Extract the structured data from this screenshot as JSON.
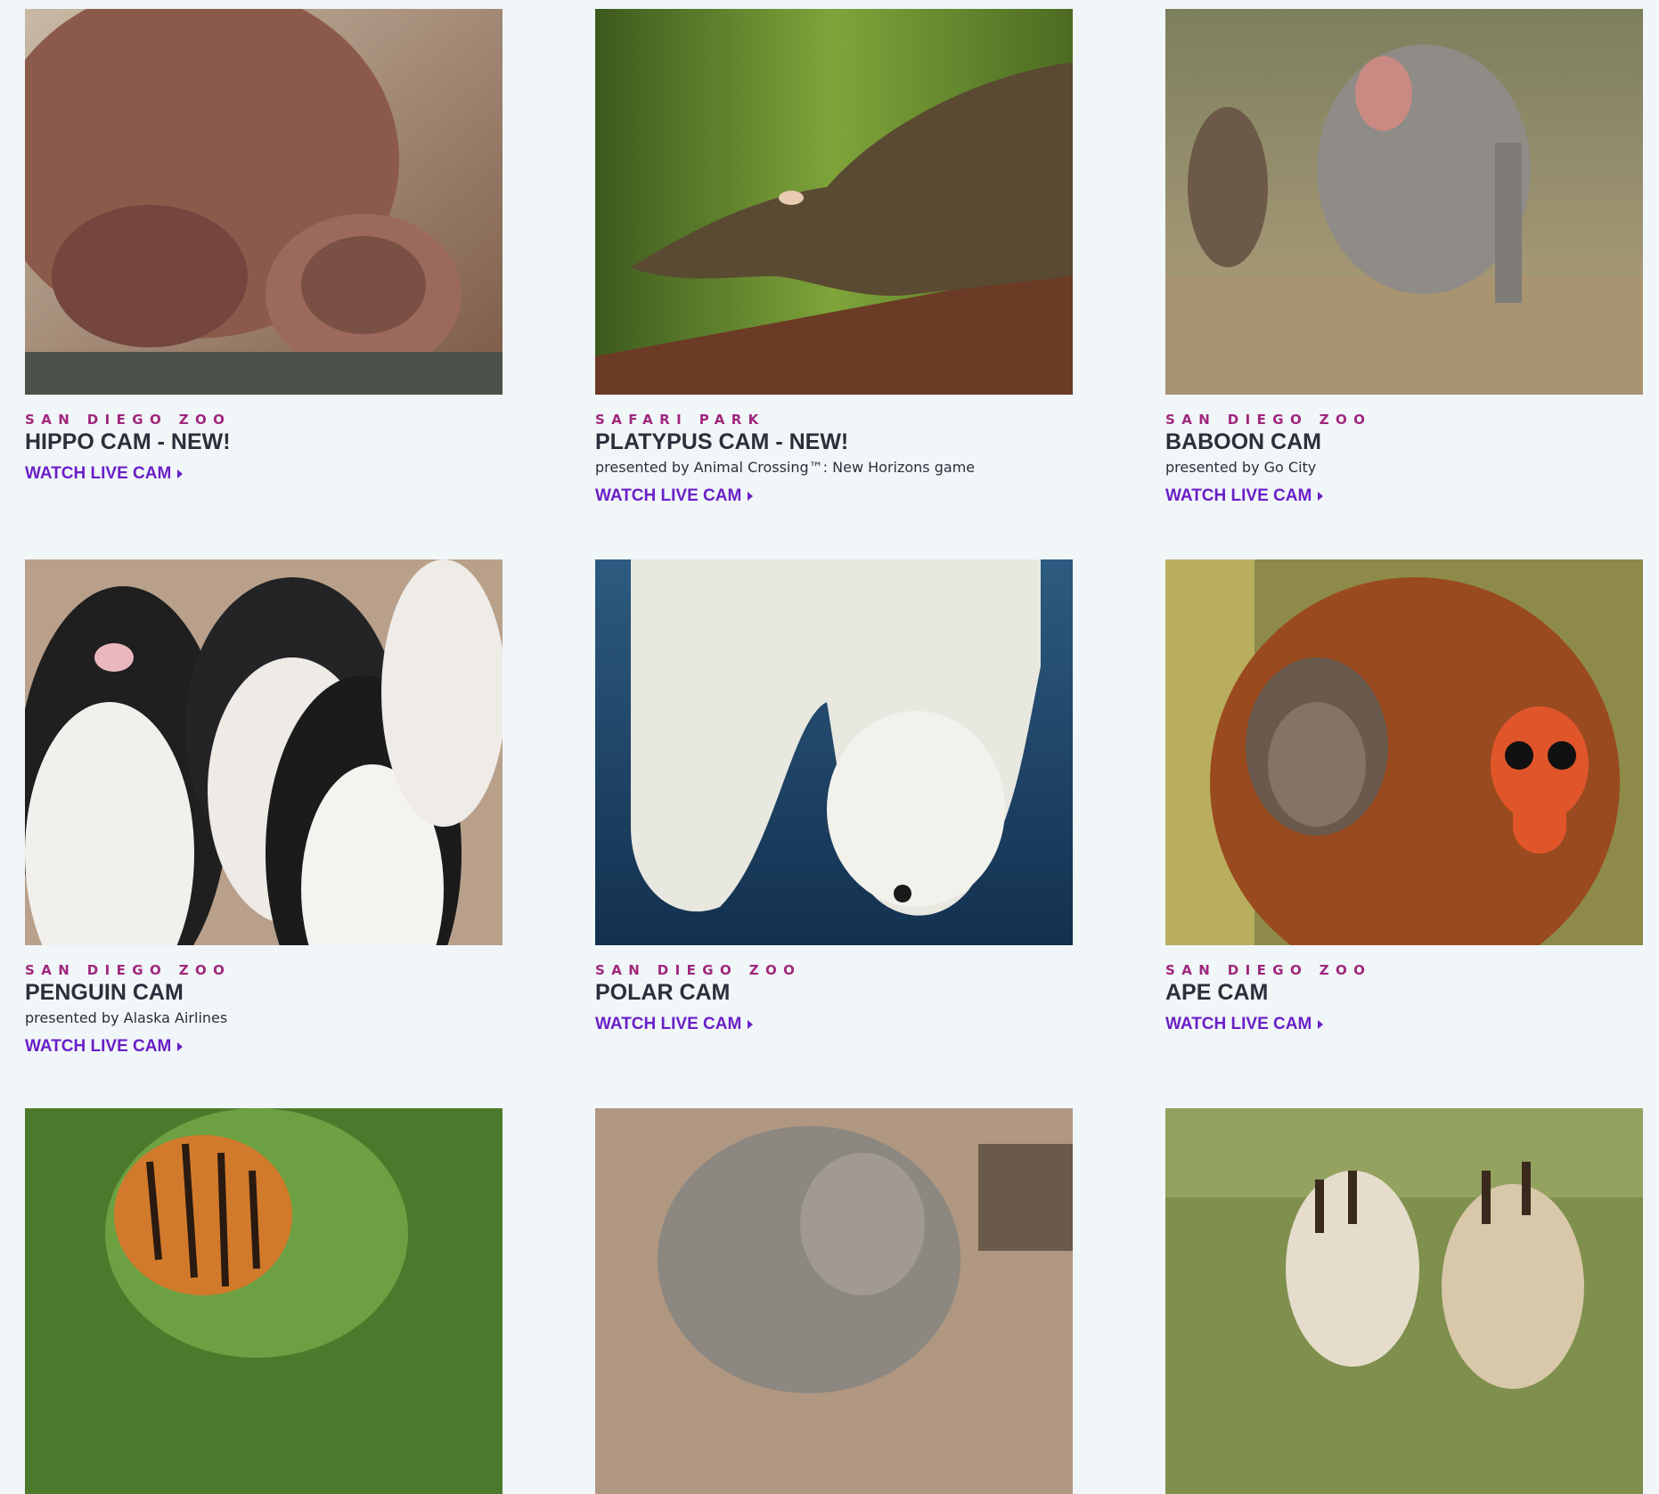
{
  "cams": [
    {
      "location": "San Diego Zoo",
      "title": "HIPPO CAM - NEW!",
      "presenter": "",
      "link": "WATCH LIVE CAM",
      "image": "hippo-photo"
    },
    {
      "location": "Safari Park",
      "title": "PLATYPUS CAM - NEW!",
      "presenter": "presented by Animal Crossing™: New Horizons game",
      "link": "WATCH LIVE CAM",
      "image": "platypus-photo"
    },
    {
      "location": "San Diego Zoo",
      "title": "BABOON CAM",
      "presenter": "presented by Go City",
      "link": "WATCH LIVE CAM",
      "image": "baboon-photo"
    },
    {
      "location": "San Diego Zoo",
      "title": "PENGUIN CAM",
      "presenter": "presented by Alaska Airlines",
      "link": "WATCH LIVE CAM",
      "image": "penguin-photo"
    },
    {
      "location": "San Diego Zoo",
      "title": "POLAR CAM",
      "presenter": "",
      "link": "WATCH LIVE CAM",
      "image": "polar-bear-photo"
    },
    {
      "location": "San Diego Zoo",
      "title": "APE CAM",
      "presenter": "",
      "link": "WATCH LIVE CAM",
      "image": "orangutan-photo"
    },
    {
      "image": "tiger-photo"
    },
    {
      "image": "elephant-photo"
    },
    {
      "image": "giraffe-photo"
    }
  ],
  "colors": {
    "background": "#f1f6f9",
    "location": "#a0277c",
    "title": "#2a2f3a",
    "link": "#6a1fc7"
  }
}
